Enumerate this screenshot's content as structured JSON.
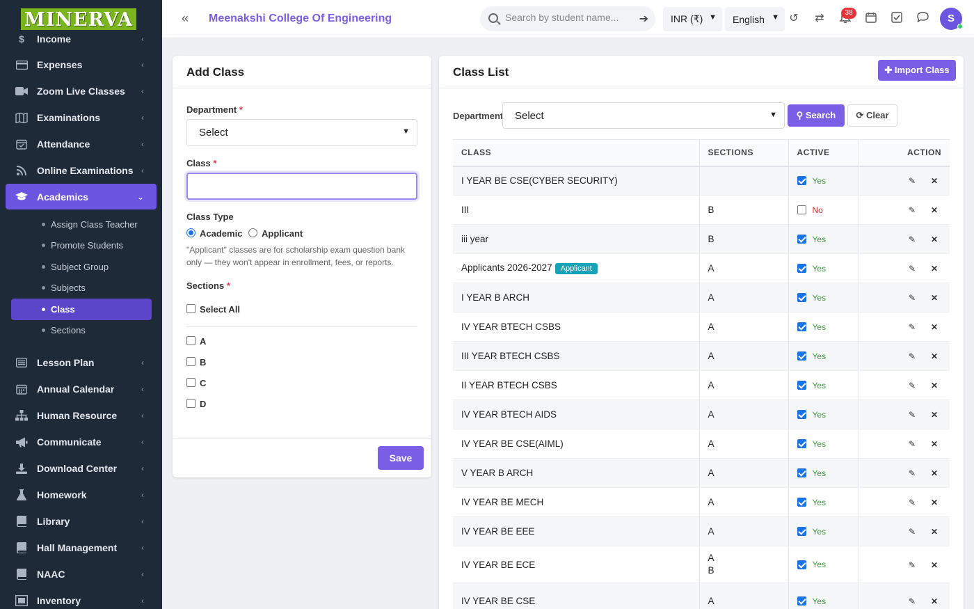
{
  "brand": {
    "logo_text": "MINERVA"
  },
  "sidebar": {
    "partial_item": "Income",
    "items": [
      {
        "key": "expenses",
        "label": "Expenses",
        "icon": "card-icon"
      },
      {
        "key": "zoom",
        "label": "Zoom Live Classes",
        "icon": "video-icon"
      },
      {
        "key": "exams",
        "label": "Examinations",
        "icon": "map-icon"
      },
      {
        "key": "attendance",
        "label": "Attendance",
        "icon": "calendar-check-icon"
      },
      {
        "key": "online-exams",
        "label": "Online Examinations",
        "icon": "rss-icon"
      },
      {
        "key": "academics",
        "label": "Academics",
        "icon": "graduation-cap-icon"
      }
    ],
    "submenu": [
      {
        "key": "assign-class-teacher",
        "label": "Assign Class Teacher"
      },
      {
        "key": "promote-students",
        "label": "Promote Students"
      },
      {
        "key": "subject-group",
        "label": "Subject Group"
      },
      {
        "key": "subjects",
        "label": "Subjects"
      },
      {
        "key": "class",
        "label": "Class"
      },
      {
        "key": "sections",
        "label": "Sections"
      }
    ],
    "items2": [
      {
        "key": "lesson-plan",
        "label": "Lesson Plan",
        "icon": "list-icon"
      },
      {
        "key": "annual-calendar",
        "label": "Annual Calendar",
        "icon": "calendar-icon"
      },
      {
        "key": "human-resource",
        "label": "Human Resource",
        "icon": "sitemap-icon"
      },
      {
        "key": "communicate",
        "label": "Communicate",
        "icon": "bullhorn-icon"
      },
      {
        "key": "download-center",
        "label": "Download Center",
        "icon": "download-icon"
      },
      {
        "key": "homework",
        "label": "Homework",
        "icon": "flask-icon"
      },
      {
        "key": "library",
        "label": "Library",
        "icon": "book-icon"
      },
      {
        "key": "hall-management",
        "label": "Hall Management",
        "icon": "book-icon"
      },
      {
        "key": "naac",
        "label": "NAAC",
        "icon": "book-icon"
      },
      {
        "key": "inventory",
        "label": "Inventory",
        "icon": "inventory-icon"
      }
    ]
  },
  "header": {
    "college_name": "Meenakshi College Of Engineering",
    "search_placeholder": "Search by student name...",
    "currency": "INR (₹)",
    "language": "English",
    "notification_count": "38",
    "avatar_initial": "S"
  },
  "add_class": {
    "title": "Add Class",
    "department_label": "Department",
    "department_value": "Select",
    "class_label": "Class",
    "class_value": "",
    "class_type_label": "Class Type",
    "class_type_options": [
      "Academic",
      "Applicant"
    ],
    "class_type_selected": "Academic",
    "help_text": "\"Applicant\" classes are for scholarship exam question bank only — they won't appear in enrollment, fees, or reports.",
    "sections_label": "Sections",
    "select_all_label": "Select All",
    "sections": [
      "A",
      "B",
      "C",
      "D"
    ],
    "save_label": "Save"
  },
  "class_list": {
    "title": "Class List",
    "import_label": "Import Class",
    "department_label": "Department",
    "department_value": "Select",
    "search_label": "Search",
    "clear_label": "Clear",
    "columns": [
      "CLASS",
      "SECTIONS",
      "ACTIVE",
      "ACTION"
    ],
    "rows": [
      {
        "name": "I YEAR BE CSE(CYBER SECURITY)",
        "sections": [],
        "active": true,
        "status": "Yes"
      },
      {
        "name": "III",
        "sections": [
          "B"
        ],
        "active": false,
        "status": "No"
      },
      {
        "name": "iii year",
        "sections": [
          "B"
        ],
        "active": true,
        "status": "Yes"
      },
      {
        "name": "Applicants 2026-2027",
        "badge": "Applicant",
        "sections": [
          "A"
        ],
        "active": true,
        "status": "Yes"
      },
      {
        "name": "I YEAR B ARCH",
        "sections": [
          "A"
        ],
        "active": true,
        "status": "Yes"
      },
      {
        "name": "IV YEAR BTECH CSBS",
        "sections": [
          "A"
        ],
        "active": true,
        "status": "Yes"
      },
      {
        "name": "III YEAR BTECH CSBS",
        "sections": [
          "A"
        ],
        "active": true,
        "status": "Yes"
      },
      {
        "name": "II YEAR BTECH CSBS",
        "sections": [
          "A"
        ],
        "active": true,
        "status": "Yes"
      },
      {
        "name": "IV YEAR BTECH AIDS",
        "sections": [
          "A"
        ],
        "active": true,
        "status": "Yes"
      },
      {
        "name": "IV YEAR BE CSE(AIML)",
        "sections": [
          "A"
        ],
        "active": true,
        "status": "Yes"
      },
      {
        "name": "V YEAR B ARCH",
        "sections": [
          "A"
        ],
        "active": true,
        "status": "Yes"
      },
      {
        "name": "IV YEAR BE MECH",
        "sections": [
          "A"
        ],
        "active": true,
        "status": "Yes"
      },
      {
        "name": "IV YEAR BE EEE",
        "sections": [
          "A"
        ],
        "active": true,
        "status": "Yes"
      },
      {
        "name": "IV YEAR BE ECE",
        "sections": [
          "A",
          "B"
        ],
        "active": true,
        "status": "Yes"
      },
      {
        "name": "IV YEAR BE CSE",
        "sections": [
          "A"
        ],
        "active": true,
        "status": "Yes"
      }
    ]
  }
}
